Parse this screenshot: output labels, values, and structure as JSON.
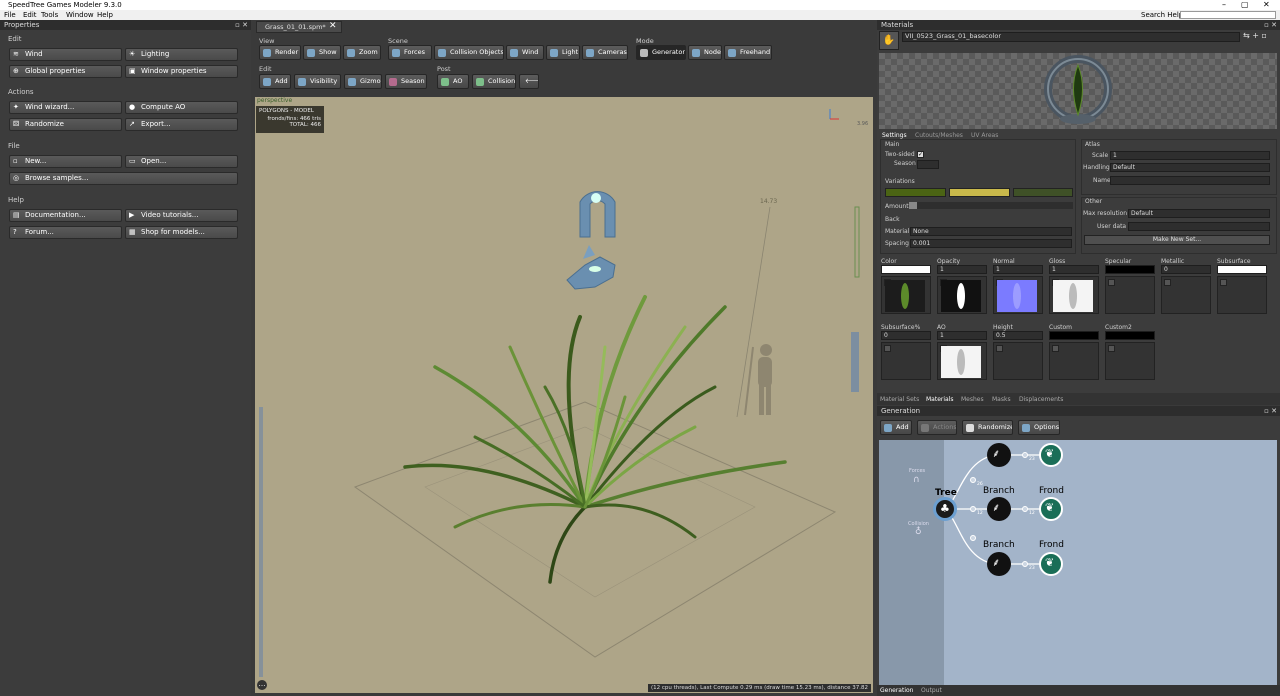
{
  "window": {
    "title": "SpeedTree Games Modeler 9.3.0",
    "controls": [
      "–",
      "▢",
      "✕"
    ]
  },
  "menu": {
    "items": [
      "File",
      "Edit",
      "Tools",
      "Window",
      "Help"
    ],
    "search_label": "Search Help:"
  },
  "properties": {
    "title": "Properties",
    "edit": {
      "label": "Edit",
      "buttons": [
        "Wind",
        "Lighting",
        "Global properties",
        "Window properties"
      ]
    },
    "actions": {
      "label": "Actions",
      "buttons": [
        "Wind wizard...",
        "Compute AO",
        "Randomize",
        "Export..."
      ]
    },
    "file": {
      "label": "File",
      "buttons": [
        "New...",
        "Open...",
        "Browse samples..."
      ]
    },
    "help": {
      "label": "Help",
      "buttons": [
        "Documentation...",
        "Video tutorials...",
        "Forum...",
        "Shop for models..."
      ]
    }
  },
  "document_tab": {
    "name": "Grass_01_01.spm*"
  },
  "toolbar": {
    "view": {
      "label": "View",
      "buttons": [
        "Render",
        "Show",
        "Zoom"
      ]
    },
    "scene": {
      "label": "Scene",
      "buttons": [
        "Forces",
        "Collision Objects",
        "Wind",
        "Light",
        "Cameras"
      ]
    },
    "mode": {
      "label": "Mode",
      "buttons": [
        "Generator",
        "Node",
        "Freehand"
      ]
    },
    "edit": {
      "label": "Edit",
      "buttons": [
        "Add",
        "Visibility",
        "Gizmo",
        "Season"
      ]
    },
    "post": {
      "label": "Post",
      "buttons": [
        "AO",
        "Collision"
      ]
    }
  },
  "viewport": {
    "camera_label": "perspective",
    "stats_title": "POLYGONS - MODEL",
    "stats_fronds_label": "fronds/fins:",
    "stats_fronds_value": "466 tris",
    "stats_total_label": "TOTAL:",
    "stats_total_value": "466",
    "height_marker": "14.73",
    "axis_value": "3.96",
    "status": "(12 cpu threads), Last Compute 0.29 ms (draw time 15.23 ms), distance 37.82"
  },
  "materials": {
    "title": "Materials",
    "selected": "VII_0523_Grass_01_basecolor",
    "tabs": [
      "Settings",
      "Cutouts/Meshes",
      "UV Areas"
    ],
    "main_label": "Main",
    "two_sided_label": "Two-sided",
    "season_label": "Season",
    "variations_label": "Variations",
    "variation_colors": [
      "#4b6414",
      "#c9b94b",
      "#3f5127"
    ],
    "amount_label": "Amount",
    "back_label": "Back",
    "material_label": "Material",
    "material_value": "None",
    "spacing_label": "Spacing",
    "spacing_value": "0.001",
    "atlas_label": "Atlas",
    "scale_label": "Scale",
    "scale_value": "1",
    "handling_label": "Handling",
    "handling_value": "Default",
    "name_label": "Name",
    "other_label": "Other",
    "max_resolution_label": "Max resolution",
    "max_resolution_value": "Default",
    "user_data_label": "User data",
    "make_set_button": "Make New Set...",
    "maps_row1": [
      {
        "name": "Color",
        "value": ""
      },
      {
        "name": "Opacity",
        "value": "1"
      },
      {
        "name": "Normal",
        "value": "1"
      },
      {
        "name": "Gloss",
        "value": "1"
      },
      {
        "name": "Specular",
        "value": ""
      },
      {
        "name": "Metallic",
        "value": "0"
      },
      {
        "name": "Subsurface",
        "value": ""
      }
    ],
    "maps_row2": [
      {
        "name": "Subsurface%",
        "value": "0"
      },
      {
        "name": "AO",
        "value": "1"
      },
      {
        "name": "Height",
        "value": "0.5"
      },
      {
        "name": "Custom",
        "value": ""
      },
      {
        "name": "Custom2",
        "value": ""
      }
    ],
    "bottom_tabs": [
      "Material Sets",
      "Materials",
      "Meshes",
      "Masks",
      "Displacements"
    ]
  },
  "generation": {
    "title": "Generation",
    "toolbar": [
      "Add",
      "Actions",
      "Randomize",
      "Options"
    ],
    "side_labels": [
      "Forces",
      "Collision"
    ],
    "nodes": {
      "tree": "Tree",
      "branch1": "Branch",
      "frond1": "Frond",
      "branch2": "Branch",
      "frond2": "Frond"
    },
    "connector_labels": [
      "26",
      "12",
      "23",
      "12",
      "23"
    ],
    "bottom_tabs": [
      "Generation",
      "Output"
    ]
  },
  "colors": {
    "viewport_bg": "#aea588",
    "gen_bg": "#a3b4c9",
    "accent_blue": "#5e8fb8"
  }
}
